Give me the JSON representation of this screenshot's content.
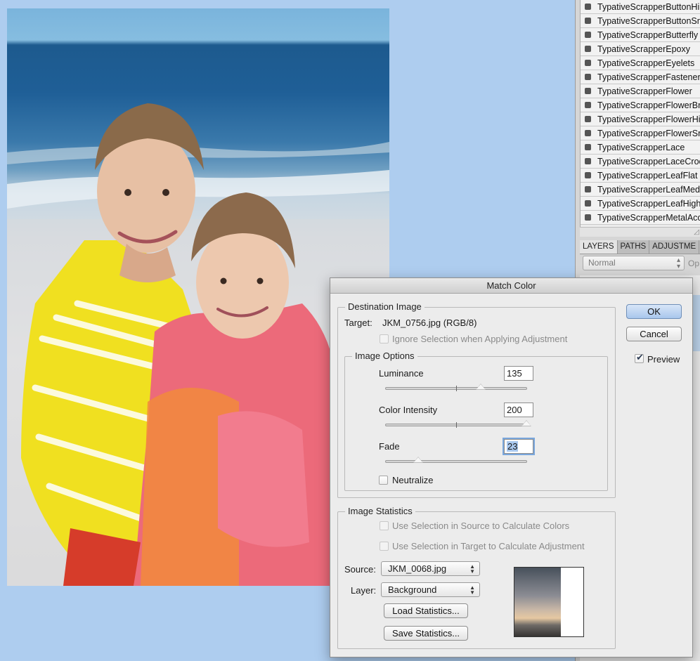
{
  "style_list": {
    "items": [
      "TypativeScrapperButtonHi",
      "TypativeScrapperButtonSn",
      "TypativeScrapperButterfly",
      "TypativeScrapperEpoxy",
      "TypativeScrapperEyelets",
      "TypativeScrapperFastener",
      "TypativeScrapperFlower",
      "TypativeScrapperFlowerBr",
      "TypativeScrapperFlowerHi",
      "TypativeScrapperFlowerSn",
      "TypativeScrapperLace",
      "TypativeScrapperLaceCroc",
      "TypativeScrapperLeafFlat",
      "TypativeScrapperLeafMed",
      "TypativeScrapperLeafHigh",
      "TypativeScrapperMetalAcc"
    ]
  },
  "layers_panel": {
    "tabs": [
      "LAYERS",
      "PATHS",
      "ADJUSTME"
    ],
    "blend_mode": "Normal",
    "opacity_label": "Op"
  },
  "dialog": {
    "title": "Match Color",
    "destination_image": {
      "legend": "Destination Image",
      "target_label": "Target:",
      "target_value": "JKM_0756.jpg (RGB/8)",
      "ignore_selection_label": "Ignore Selection when Applying Adjustment"
    },
    "image_options": {
      "legend": "Image Options",
      "luminance_label": "Luminance",
      "luminance_value": "135",
      "color_intensity_label": "Color Intensity",
      "color_intensity_value": "200",
      "fade_label": "Fade",
      "fade_value": "23",
      "neutralize_label": "Neutralize"
    },
    "image_statistics": {
      "legend": "Image Statistics",
      "use_source_label": "Use Selection in Source to Calculate Colors",
      "use_target_label": "Use Selection in Target to Calculate Adjustment",
      "source_label": "Source:",
      "source_value": "JKM_0068.jpg",
      "layer_label": "Layer:",
      "layer_value": "Background",
      "load_stats_label": "Load Statistics...",
      "save_stats_label": "Save Statistics..."
    },
    "ok_label": "OK",
    "cancel_label": "Cancel",
    "preview_label": "Preview",
    "preview_checked": true
  },
  "slider_levels": {
    "luminance": {
      "value": 135,
      "max": 200
    },
    "color_intensity": {
      "value": 200,
      "max": 200
    },
    "fade": {
      "value": 23,
      "max": 100
    }
  },
  "colors": {
    "desktop_background": "#aecdef",
    "default_button": "#a8c6ec"
  },
  "icons": [
    "style-swatch-icon",
    "popup-arrows-icon",
    "checkmark-icon",
    "slider-thumb-icon"
  ]
}
